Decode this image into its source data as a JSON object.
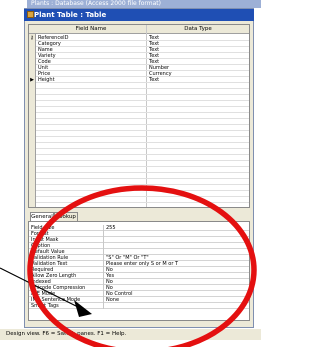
{
  "outer_title": "Plants : Database (Access 2000 file format)",
  "window": {
    "title": "Plant Table : Table"
  },
  "grid": {
    "columns": [
      "Field Name",
      "Data Type"
    ],
    "rows": [
      {
        "name": "ReferenceID",
        "type": "Text",
        "key": true
      },
      {
        "name": "Category",
        "type": "Text"
      },
      {
        "name": "Name",
        "type": "Text"
      },
      {
        "name": "Variety",
        "type": "Text"
      },
      {
        "name": "Code",
        "type": "Text"
      },
      {
        "name": "Unit",
        "type": "Number"
      },
      {
        "name": "Price",
        "type": "Currency"
      },
      {
        "name": "Height",
        "type": "Text",
        "current": true
      }
    ],
    "row_indicator": "▶"
  },
  "props": {
    "tabs": [
      "General",
      "Lookup"
    ],
    "rows": [
      {
        "label": "Field Size",
        "value": "255"
      },
      {
        "label": "Format",
        "value": ""
      },
      {
        "label": "Input Mask",
        "value": ""
      },
      {
        "label": "Caption",
        "value": ""
      },
      {
        "label": "Default Value",
        "value": ""
      },
      {
        "label": "Validation Rule",
        "value": "\"S\" Or \"M\" Or \"T\""
      },
      {
        "label": "Validation Text",
        "value": "Please enter only S or M or T"
      },
      {
        "label": "Required",
        "value": "No"
      },
      {
        "label": "Allow Zero Length",
        "value": "Yes"
      },
      {
        "label": "Indexed",
        "value": "No"
      },
      {
        "label": "Unicode Compression",
        "value": "No"
      },
      {
        "label": "IME Mode",
        "value": "No Control"
      },
      {
        "label": "IME Sentence Mode",
        "value": "None"
      },
      {
        "label": "Smart Tags",
        "value": ""
      }
    ]
  },
  "status": "Design view.  F6 = Switch panes.  F1 = Help.",
  "colors": {
    "title_bar": "#1f4fb4",
    "annotation_circle": "#e41010",
    "annotation_arrow": "#000000"
  }
}
